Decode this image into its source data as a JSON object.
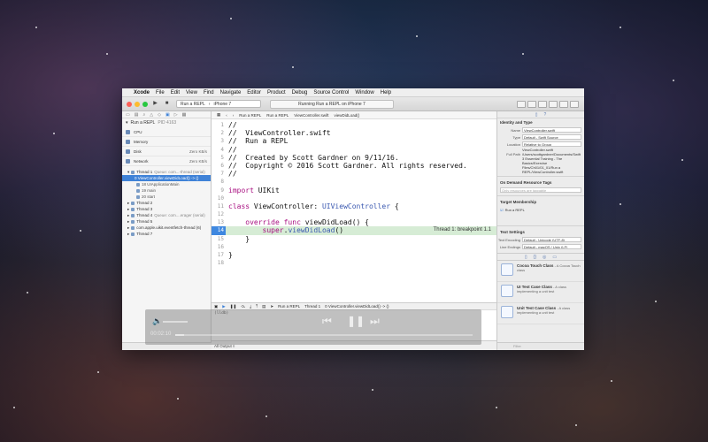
{
  "menubar": {
    "apple": "",
    "items": [
      "Xcode",
      "File",
      "Edit",
      "View",
      "Find",
      "Navigate",
      "Editor",
      "Product",
      "Debug",
      "Source Control",
      "Window",
      "Help"
    ]
  },
  "toolbar": {
    "scheme_target": "Run a REPL",
    "scheme_device": "iPhone 7",
    "activity": "Running Run a REPL on iPhone 7"
  },
  "navigator": {
    "process": "Run a REPL",
    "pid": "PID 4163",
    "gauges": [
      {
        "label": "CPU",
        "value": ""
      },
      {
        "label": "Memory",
        "value": ""
      },
      {
        "label": "Disk",
        "value": "Zero KB/s"
      },
      {
        "label": "Network",
        "value": "Zero KB/s"
      }
    ],
    "threads": [
      {
        "label": "Thread 1",
        "detail": "Queue: com...-thread (serial)",
        "kind": "thread"
      },
      {
        "label": "0 ViewController.viewDidLoad() -> ()",
        "detail": "",
        "kind": "selected"
      },
      {
        "label": "18 UIApplicationMain",
        "detail": "",
        "kind": "frame"
      },
      {
        "label": "19 main",
        "detail": "",
        "kind": "frame"
      },
      {
        "label": "20 start",
        "detail": "",
        "kind": "frame"
      },
      {
        "label": "Thread 2",
        "detail": "",
        "kind": "thread"
      },
      {
        "label": "Thread 3",
        "detail": "",
        "kind": "thread"
      },
      {
        "label": "Thread 4",
        "detail": "Queue: com....erager (serial)",
        "kind": "thread"
      },
      {
        "label": "Thread 5",
        "detail": "",
        "kind": "thread"
      },
      {
        "label": "com.apple.uikit.eventfetch-thread (6)",
        "detail": "",
        "kind": "thread"
      },
      {
        "label": "Thread 7",
        "detail": "",
        "kind": "thread"
      }
    ]
  },
  "jumpbar": {
    "items": [
      "Run a REPL",
      "Run a REPL",
      "ViewController.swift",
      "viewDidLoad()"
    ]
  },
  "code": {
    "breakpoint_label": "Thread 1: breakpoint 1.1"
  },
  "debug": {
    "bar_items": [
      "Run a REPL",
      "Thread 1",
      "0 ViewController.viewDidLoad() -> ()"
    ],
    "prompt": "(lldb)",
    "output_label": "All Output ◊"
  },
  "inspector": {
    "identity_header": "Identity and Type",
    "name_label": "Name",
    "name_value": "ViewController.swift",
    "type_label": "Type",
    "type_value": "Default - Swift Source",
    "location_label": "Location",
    "location_value": "Relative to Group",
    "location_file": "ViewController.swift",
    "fullpath_label": "Full Path",
    "fullpath_value": "/Users/scottgardner/Documents/Swift 3 Essential Training - The Basics/Exercise Files/Ch01/01_01/Run a REPL/ViewController.swift",
    "odr_header": "On Demand Resource Tags",
    "odr_placeholder": "Only resources are taggable",
    "membership_header": "Target Membership",
    "membership_item": "Run a REPL",
    "text_header": "Text Settings",
    "encoding_label": "Text Encoding",
    "encoding_value": "Default - Unicode (UTF-8)",
    "endings_label": "Line Endings",
    "endings_value": "Default - macOS / Unix (LF)",
    "library": [
      {
        "title": "Cocoa Touch Class",
        "desc": "- A Cocoa Touch class"
      },
      {
        "title": "UI Test Case Class",
        "desc": "- A class implementing a unit test"
      },
      {
        "title": "Unit Test Case Class",
        "desc": "- A class implementing a unit test"
      }
    ],
    "filter": "Filter"
  },
  "player": {
    "timecode": "00:02:10",
    "progress": 0.03
  }
}
